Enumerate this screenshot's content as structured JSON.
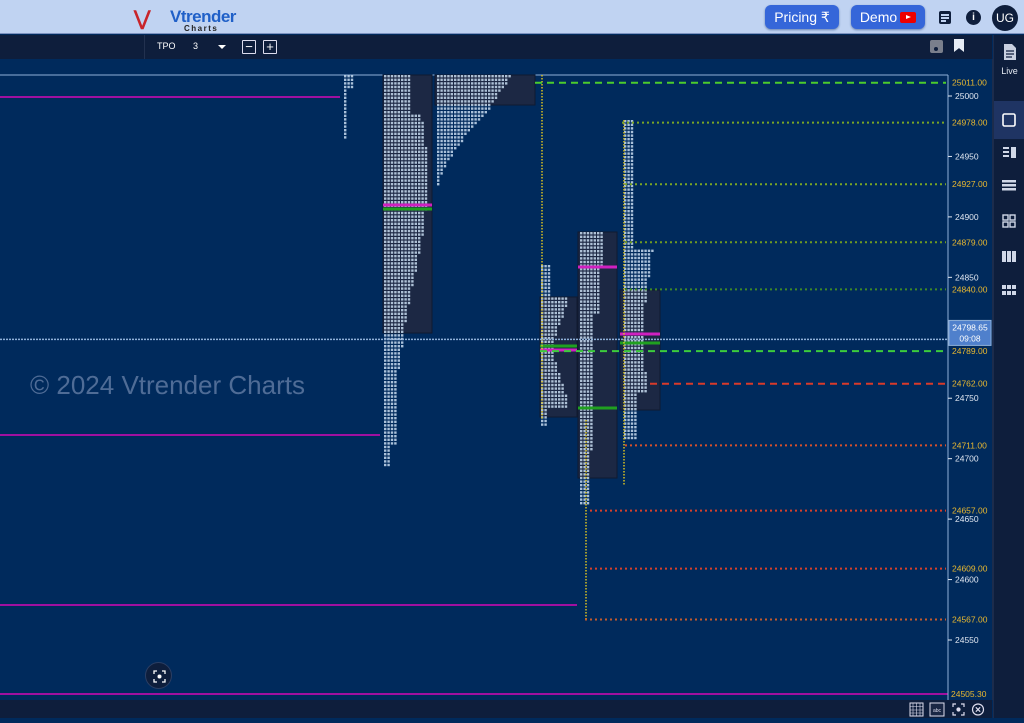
{
  "header": {
    "logo_text": "Vtrender",
    "logo_sub": "Charts",
    "pricing_label": "Pricing ₹",
    "demo_label": "Demo",
    "avatar_initials": "UG"
  },
  "toolbar": {
    "chart_type": "TPO",
    "tpo_size": "3"
  },
  "sidebar": {
    "live_label": "Live",
    "items": [
      "live",
      "single-chart",
      "split-view",
      "stacked-view",
      "grid-view",
      "columns-view",
      "multi-grid-view"
    ],
    "selected": "single-chart"
  },
  "watermark": "© 2024 Vtrender Charts",
  "price_axis": {
    "ticks": [
      "25000",
      "24950",
      "24900",
      "24850",
      "24750",
      "24700",
      "24650",
      "24600",
      "24550"
    ],
    "current_price": "24798.65",
    "current_time": "09:08",
    "bottom_label": "24505.30"
  },
  "levels": [
    {
      "label": "25011.00",
      "price": 25011,
      "color": "#4ccc2c",
      "style": "dashed"
    },
    {
      "label": "24978.00",
      "price": 24978,
      "color": "#7aa624",
      "style": "dotted"
    },
    {
      "label": "24927.00",
      "price": 24927,
      "color": "#7aa624",
      "style": "dotted"
    },
    {
      "label": "24879.00",
      "price": 24879,
      "color": "#6f9a22",
      "style": "dotted"
    },
    {
      "label": "24840.00",
      "price": 24840,
      "color": "#3f8a26",
      "style": "dotted"
    },
    {
      "label": "24789.00",
      "price": 24789,
      "color": "#3ccc3c",
      "style": "dashed"
    },
    {
      "label": "24762.00",
      "price": 24762,
      "color": "#d83a2a",
      "style": "dashed"
    },
    {
      "label": "24711.00",
      "price": 24711,
      "color": "#d8502a",
      "style": "dotted"
    },
    {
      "label": "24657.00",
      "price": 24657,
      "color": "#d8402a",
      "style": "dotted"
    },
    {
      "label": "24609.00",
      "price": 24609,
      "color": "#d8402a",
      "style": "dotted"
    },
    {
      "label": "24567.00",
      "price": 24567,
      "color": "#c85a2a",
      "style": "dotted"
    }
  ],
  "colors": {
    "background": "#002a5c",
    "poc": "#d020c0",
    "vwap": "#20a020",
    "tpo": "#c8dcf0",
    "single_prints": "#d8c020",
    "magenta_level": "#a010a0"
  },
  "bottom_bar": {
    "icons": [
      "grid-icon",
      "abc-icon",
      "fullscreen-icon",
      "close-icon"
    ]
  }
}
